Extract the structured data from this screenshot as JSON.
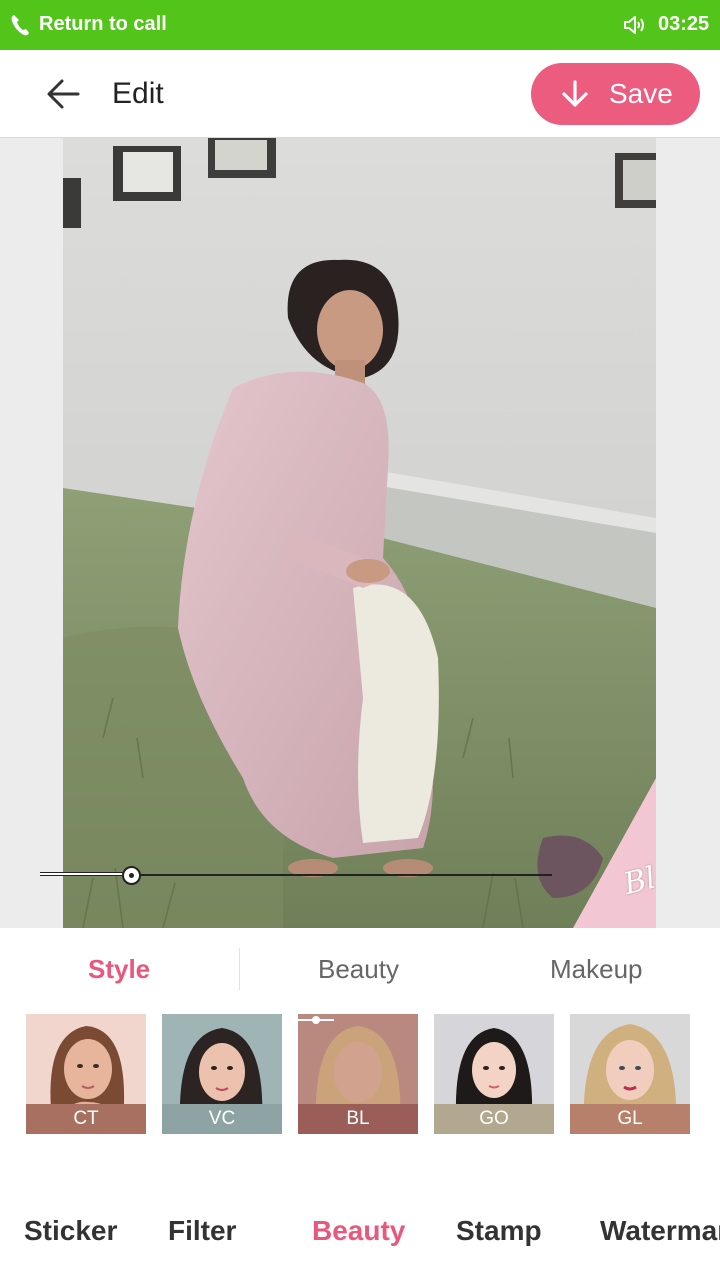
{
  "status_bar": {
    "call_text": "Return to call",
    "time": "03:25",
    "background": "#52c41a"
  },
  "header": {
    "title": "Edit",
    "save_label": "Save",
    "save_color": "#ec5c7f",
    "back_icon": "arrow-left-icon",
    "save_icon": "download-arrow-icon"
  },
  "canvas": {
    "watermark": "Bloom",
    "slider_value": 0.18
  },
  "subtabs": [
    {
      "label": "Style",
      "active": true
    },
    {
      "label": "Beauty",
      "active": false
    },
    {
      "label": "Makeup",
      "active": false
    }
  ],
  "styles": [
    {
      "label": "CT",
      "color": "#a87060"
    },
    {
      "label": "VC",
      "color": "#8ea4a4"
    },
    {
      "label": "BL",
      "color": "#9a5d57"
    },
    {
      "label": "GO",
      "color": "#b2a88f"
    },
    {
      "label": "GL",
      "color": "#b7806a"
    }
  ],
  "bottom_tabs": [
    {
      "label": "Sticker",
      "active": false
    },
    {
      "label": "Filter",
      "active": false
    },
    {
      "label": "Beauty",
      "active": true
    },
    {
      "label": "Stamp",
      "active": false
    },
    {
      "label": "Watermark",
      "active": false
    }
  ],
  "accent": "#e8587d"
}
